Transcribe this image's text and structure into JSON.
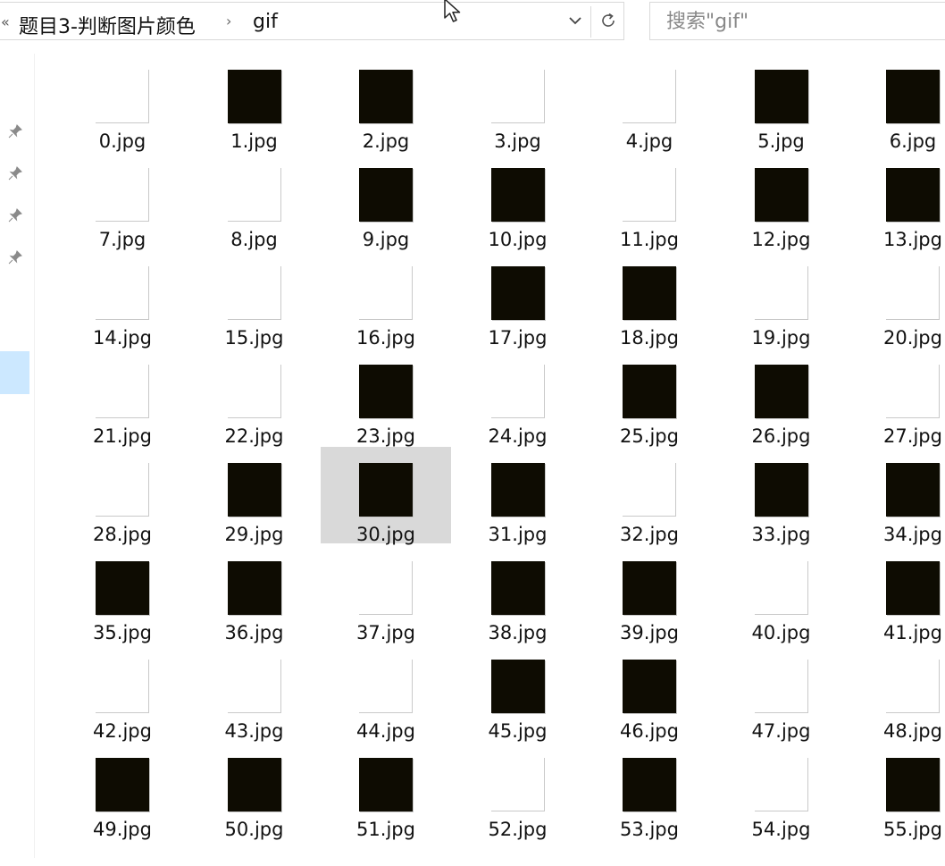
{
  "address_bar": {
    "breadcrumbs": [
      "题目3-判断图片颜色",
      "gif"
    ],
    "separator": "›",
    "overflow_chevron": "«",
    "dropdown_icon": "chevron-down-icon",
    "refresh_icon": "refresh-icon"
  },
  "search": {
    "placeholder": "搜索\"gif\"",
    "value": ""
  },
  "sidebar": {
    "pins": [
      "pin-icon",
      "pin-icon",
      "pin-icon",
      "pin-icon"
    ]
  },
  "colors": {
    "black_thumb": "#0e0c02",
    "white_thumb": "#ffffff",
    "selection": "#d9d9d9",
    "nav_selected": "#cce8ff"
  },
  "selected_file": "30.jpg",
  "files": [
    {
      "name": "0.jpg",
      "color": "white"
    },
    {
      "name": "1.jpg",
      "color": "black"
    },
    {
      "name": "2.jpg",
      "color": "black"
    },
    {
      "name": "3.jpg",
      "color": "white"
    },
    {
      "name": "4.jpg",
      "color": "white"
    },
    {
      "name": "5.jpg",
      "color": "black"
    },
    {
      "name": "6.jpg",
      "color": "black"
    },
    {
      "name": "7.jpg",
      "color": "white"
    },
    {
      "name": "8.jpg",
      "color": "white"
    },
    {
      "name": "9.jpg",
      "color": "black"
    },
    {
      "name": "10.jpg",
      "color": "black"
    },
    {
      "name": "11.jpg",
      "color": "white"
    },
    {
      "name": "12.jpg",
      "color": "black"
    },
    {
      "name": "13.jpg",
      "color": "black"
    },
    {
      "name": "14.jpg",
      "color": "white"
    },
    {
      "name": "15.jpg",
      "color": "white"
    },
    {
      "name": "16.jpg",
      "color": "white"
    },
    {
      "name": "17.jpg",
      "color": "black"
    },
    {
      "name": "18.jpg",
      "color": "black"
    },
    {
      "name": "19.jpg",
      "color": "white"
    },
    {
      "name": "20.jpg",
      "color": "white"
    },
    {
      "name": "21.jpg",
      "color": "white"
    },
    {
      "name": "22.jpg",
      "color": "white"
    },
    {
      "name": "23.jpg",
      "color": "black"
    },
    {
      "name": "24.jpg",
      "color": "white"
    },
    {
      "name": "25.jpg",
      "color": "black"
    },
    {
      "name": "26.jpg",
      "color": "black"
    },
    {
      "name": "27.jpg",
      "color": "white"
    },
    {
      "name": "28.jpg",
      "color": "white"
    },
    {
      "name": "29.jpg",
      "color": "black"
    },
    {
      "name": "30.jpg",
      "color": "black"
    },
    {
      "name": "31.jpg",
      "color": "black"
    },
    {
      "name": "32.jpg",
      "color": "white"
    },
    {
      "name": "33.jpg",
      "color": "black"
    },
    {
      "name": "34.jpg",
      "color": "black"
    },
    {
      "name": "35.jpg",
      "color": "black"
    },
    {
      "name": "36.jpg",
      "color": "black"
    },
    {
      "name": "37.jpg",
      "color": "white"
    },
    {
      "name": "38.jpg",
      "color": "black"
    },
    {
      "name": "39.jpg",
      "color": "black"
    },
    {
      "name": "40.jpg",
      "color": "white"
    },
    {
      "name": "41.jpg",
      "color": "black"
    },
    {
      "name": "42.jpg",
      "color": "white"
    },
    {
      "name": "43.jpg",
      "color": "white"
    },
    {
      "name": "44.jpg",
      "color": "white"
    },
    {
      "name": "45.jpg",
      "color": "black"
    },
    {
      "name": "46.jpg",
      "color": "black"
    },
    {
      "name": "47.jpg",
      "color": "white"
    },
    {
      "name": "48.jpg",
      "color": "white"
    },
    {
      "name": "49.jpg",
      "color": "black"
    },
    {
      "name": "50.jpg",
      "color": "black"
    },
    {
      "name": "51.jpg",
      "color": "black"
    },
    {
      "name": "52.jpg",
      "color": "white"
    },
    {
      "name": "53.jpg",
      "color": "black"
    },
    {
      "name": "54.jpg",
      "color": "white"
    },
    {
      "name": "55.jpg",
      "color": "black"
    }
  ]
}
